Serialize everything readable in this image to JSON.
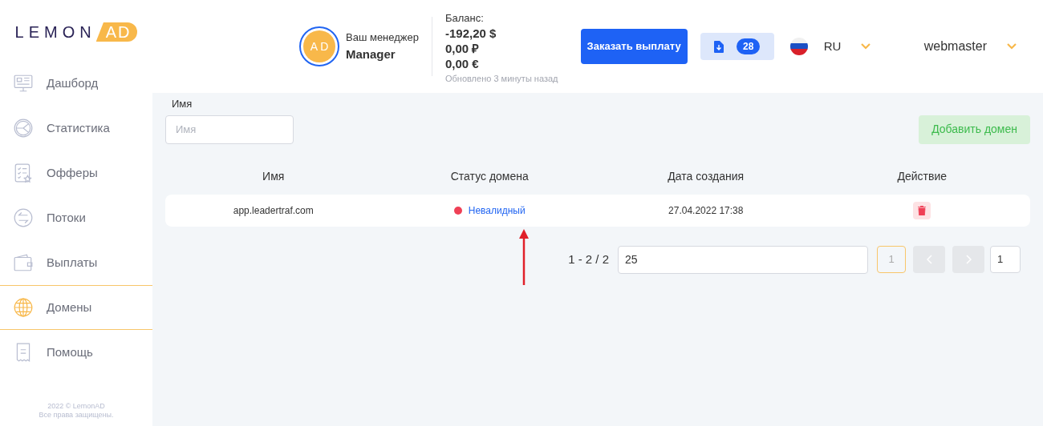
{
  "logo": {
    "left": "LEMON",
    "right": "AD"
  },
  "sidebar": {
    "items": [
      {
        "label": "Дашборд",
        "kind": "dashboard",
        "selected": false
      },
      {
        "label": "Статистика",
        "kind": "stats",
        "selected": false
      },
      {
        "label": "Офферы",
        "kind": "offers",
        "selected": false
      },
      {
        "label": "Потоки",
        "kind": "flows",
        "selected": false
      },
      {
        "label": "Выплаты",
        "kind": "wallet",
        "selected": false
      },
      {
        "label": "Домены",
        "kind": "globe",
        "selected": true
      },
      {
        "label": "Помощь",
        "kind": "help",
        "selected": false
      }
    ],
    "footer": [
      "2022 © LemonAD",
      "Все права защищены."
    ]
  },
  "header": {
    "manager": {
      "initials": "A D",
      "caption": "Ваш менеджер",
      "name": "Manager"
    },
    "balance": {
      "label": "Баланс:",
      "amounts": [
        "-192,20 $",
        "0,00 ₽",
        "0,00 €"
      ],
      "updated": "Обновлено 3 минуты назад"
    },
    "payout_button": "Заказать выплату",
    "downloads": {
      "count": "28"
    },
    "language": "RU",
    "user": "webmaster"
  },
  "filter": {
    "label": "Имя",
    "placeholder": "Имя"
  },
  "add_button": "Добавить домен",
  "table": {
    "columns": [
      "Имя",
      "Статус домена",
      "Дата создания",
      "Действие"
    ],
    "rows": [
      {
        "name": "app.leadertraf.com",
        "status": "Невалидный",
        "color": "#ef4056",
        "created": "27.04.2022 17:38"
      }
    ]
  },
  "pagination": {
    "range": "1 - 2 / 2",
    "per_page": "25",
    "current": "1",
    "page_input": "1"
  }
}
